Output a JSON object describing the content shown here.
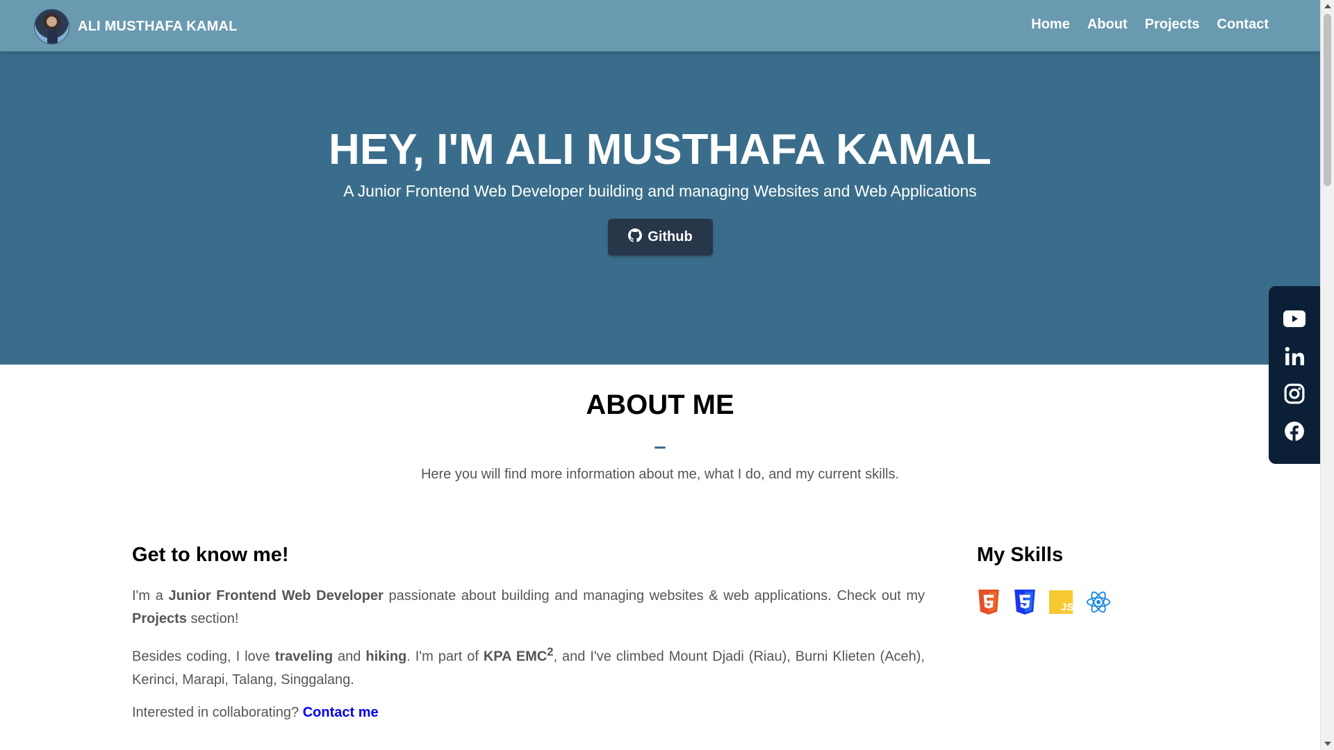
{
  "header": {
    "brand_name": "ALI MUSTHAFA KAMAL",
    "nav": [
      "Home",
      "About",
      "Projects",
      "Contact"
    ]
  },
  "hero": {
    "title": "HEY, I'M ALI MUSTHAFA KAMAL",
    "subtitle": "A Junior Frontend Web Developer building and managing Websites and Web Applications",
    "github_label": "Github"
  },
  "social": [
    "youtube-icon",
    "linkedin-icon",
    "instagram-icon",
    "facebook-icon"
  ],
  "about": {
    "title": "ABOUT ME",
    "subtitle": "Here you will find more information about me, what I do, and my current skills.",
    "know_heading": "Get to know me!",
    "p1": {
      "t1": "I'm a ",
      "b1": "Junior Frontend Web Developer",
      "t2": " passionate about building and managing websites & web applications. Check out my ",
      "b2": "Projects",
      "t3": " section!"
    },
    "p2": {
      "t1": "Besides coding, I love ",
      "b1": "traveling",
      "t2": " and ",
      "b2": "hiking",
      "t3": ". I'm part of ",
      "b3": "KPA EMC",
      "sup": "2",
      "t4": ", and I've climbed Mount Djadi (Riau), Burni Klieten (Aceh), Kerinci, Marapi, Talang, Singgalang."
    },
    "p3": {
      "t1": "Interested in collaborating? ",
      "link": "Contact me"
    },
    "skills_heading": "My Skills",
    "skills": [
      "html5-icon",
      "css3-icon",
      "javascript-icon",
      "react-icon"
    ]
  },
  "colors": {
    "navbar": "#6a9ab0",
    "hero": "#3a6d8b",
    "button": "#283649",
    "social_bar": "#0b2036",
    "link": "#0000ee"
  }
}
